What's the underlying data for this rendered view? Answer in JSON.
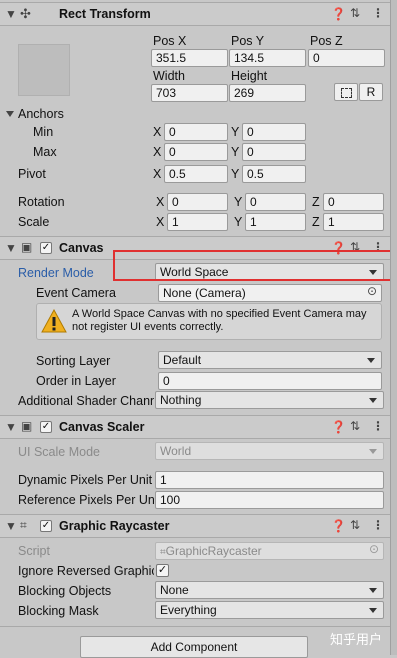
{
  "rect_transform": {
    "title": "Rect Transform",
    "pos_x_label": "Pos X",
    "pos_y_label": "Pos Y",
    "pos_z_label": "Pos Z",
    "pos_x": "351.5",
    "pos_y": "134.5",
    "pos_z": "0",
    "width_label": "Width",
    "height_label": "Height",
    "width": "703",
    "height": "269",
    "raw_button_label": "R",
    "anchors_label": "Anchors",
    "min_label": "Min",
    "max_label": "Max",
    "anchor_min_x": "0",
    "anchor_min_y": "0",
    "anchor_max_x": "0",
    "anchor_max_y": "0",
    "pivot_label": "Pivot",
    "pivot_x": "0.5",
    "pivot_y": "0.5",
    "rotation_label": "Rotation",
    "rot_x": "0",
    "rot_y": "0",
    "rot_z": "0",
    "scale_label": "Scale",
    "scale_x": "1",
    "scale_y": "1",
    "scale_z": "1",
    "x": "X",
    "y": "Y",
    "z": "Z"
  },
  "canvas": {
    "title": "Canvas",
    "render_mode_label": "Render Mode",
    "render_mode_value": "World Space",
    "event_camera_label": "Event Camera",
    "event_camera_value": "None (Camera)",
    "warning_text": "A World Space Canvas with no specified Event Camera may not register UI events correctly.",
    "sorting_layer_label": "Sorting Layer",
    "sorting_layer_value": "Default",
    "order_in_layer_label": "Order in Layer",
    "order_in_layer_value": "0",
    "shader_channels_label": "Additional Shader Chann",
    "shader_channels_value": "Nothing"
  },
  "canvas_scaler": {
    "title": "Canvas Scaler",
    "ui_scale_mode_label": "UI Scale Mode",
    "ui_scale_mode_value": "World",
    "dpu_label": "Dynamic Pixels Per Unit",
    "dpu_value": "1",
    "rppu_label": "Reference Pixels Per Un",
    "rppu_value": "100"
  },
  "graphic_raycaster": {
    "title": "Graphic Raycaster",
    "script_label": "Script",
    "script_value": "GraphicRaycaster",
    "ignore_reversed_label": "Ignore Reversed Graphic",
    "blocking_objects_label": "Blocking Objects",
    "blocking_objects_value": "None",
    "blocking_mask_label": "Blocking Mask",
    "blocking_mask_value": "Everything"
  },
  "footer": {
    "add_component_label": "Add Component",
    "watermark": "知乎用户"
  },
  "colors": {
    "highlight_box": "#e03030",
    "render_mode_label": "#2a5da8"
  }
}
